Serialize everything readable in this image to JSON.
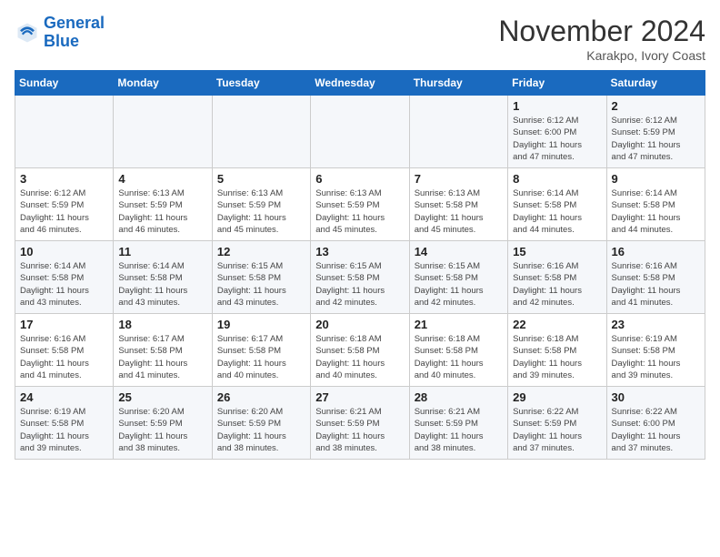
{
  "logo": {
    "name1": "General",
    "name2": "Blue"
  },
  "title": "November 2024",
  "location": "Karakpo, Ivory Coast",
  "weekdays": [
    "Sunday",
    "Monday",
    "Tuesday",
    "Wednesday",
    "Thursday",
    "Friday",
    "Saturday"
  ],
  "weeks": [
    [
      {
        "day": "",
        "info": ""
      },
      {
        "day": "",
        "info": ""
      },
      {
        "day": "",
        "info": ""
      },
      {
        "day": "",
        "info": ""
      },
      {
        "day": "",
        "info": ""
      },
      {
        "day": "1",
        "info": "Sunrise: 6:12 AM\nSunset: 6:00 PM\nDaylight: 11 hours\nand 47 minutes."
      },
      {
        "day": "2",
        "info": "Sunrise: 6:12 AM\nSunset: 5:59 PM\nDaylight: 11 hours\nand 47 minutes."
      }
    ],
    [
      {
        "day": "3",
        "info": "Sunrise: 6:12 AM\nSunset: 5:59 PM\nDaylight: 11 hours\nand 46 minutes."
      },
      {
        "day": "4",
        "info": "Sunrise: 6:13 AM\nSunset: 5:59 PM\nDaylight: 11 hours\nand 46 minutes."
      },
      {
        "day": "5",
        "info": "Sunrise: 6:13 AM\nSunset: 5:59 PM\nDaylight: 11 hours\nand 45 minutes."
      },
      {
        "day": "6",
        "info": "Sunrise: 6:13 AM\nSunset: 5:59 PM\nDaylight: 11 hours\nand 45 minutes."
      },
      {
        "day": "7",
        "info": "Sunrise: 6:13 AM\nSunset: 5:58 PM\nDaylight: 11 hours\nand 45 minutes."
      },
      {
        "day": "8",
        "info": "Sunrise: 6:14 AM\nSunset: 5:58 PM\nDaylight: 11 hours\nand 44 minutes."
      },
      {
        "day": "9",
        "info": "Sunrise: 6:14 AM\nSunset: 5:58 PM\nDaylight: 11 hours\nand 44 minutes."
      }
    ],
    [
      {
        "day": "10",
        "info": "Sunrise: 6:14 AM\nSunset: 5:58 PM\nDaylight: 11 hours\nand 43 minutes."
      },
      {
        "day": "11",
        "info": "Sunrise: 6:14 AM\nSunset: 5:58 PM\nDaylight: 11 hours\nand 43 minutes."
      },
      {
        "day": "12",
        "info": "Sunrise: 6:15 AM\nSunset: 5:58 PM\nDaylight: 11 hours\nand 43 minutes."
      },
      {
        "day": "13",
        "info": "Sunrise: 6:15 AM\nSunset: 5:58 PM\nDaylight: 11 hours\nand 42 minutes."
      },
      {
        "day": "14",
        "info": "Sunrise: 6:15 AM\nSunset: 5:58 PM\nDaylight: 11 hours\nand 42 minutes."
      },
      {
        "day": "15",
        "info": "Sunrise: 6:16 AM\nSunset: 5:58 PM\nDaylight: 11 hours\nand 42 minutes."
      },
      {
        "day": "16",
        "info": "Sunrise: 6:16 AM\nSunset: 5:58 PM\nDaylight: 11 hours\nand 41 minutes."
      }
    ],
    [
      {
        "day": "17",
        "info": "Sunrise: 6:16 AM\nSunset: 5:58 PM\nDaylight: 11 hours\nand 41 minutes."
      },
      {
        "day": "18",
        "info": "Sunrise: 6:17 AM\nSunset: 5:58 PM\nDaylight: 11 hours\nand 41 minutes."
      },
      {
        "day": "19",
        "info": "Sunrise: 6:17 AM\nSunset: 5:58 PM\nDaylight: 11 hours\nand 40 minutes."
      },
      {
        "day": "20",
        "info": "Sunrise: 6:18 AM\nSunset: 5:58 PM\nDaylight: 11 hours\nand 40 minutes."
      },
      {
        "day": "21",
        "info": "Sunrise: 6:18 AM\nSunset: 5:58 PM\nDaylight: 11 hours\nand 40 minutes."
      },
      {
        "day": "22",
        "info": "Sunrise: 6:18 AM\nSunset: 5:58 PM\nDaylight: 11 hours\nand 39 minutes."
      },
      {
        "day": "23",
        "info": "Sunrise: 6:19 AM\nSunset: 5:58 PM\nDaylight: 11 hours\nand 39 minutes."
      }
    ],
    [
      {
        "day": "24",
        "info": "Sunrise: 6:19 AM\nSunset: 5:58 PM\nDaylight: 11 hours\nand 39 minutes."
      },
      {
        "day": "25",
        "info": "Sunrise: 6:20 AM\nSunset: 5:59 PM\nDaylight: 11 hours\nand 38 minutes."
      },
      {
        "day": "26",
        "info": "Sunrise: 6:20 AM\nSunset: 5:59 PM\nDaylight: 11 hours\nand 38 minutes."
      },
      {
        "day": "27",
        "info": "Sunrise: 6:21 AM\nSunset: 5:59 PM\nDaylight: 11 hours\nand 38 minutes."
      },
      {
        "day": "28",
        "info": "Sunrise: 6:21 AM\nSunset: 5:59 PM\nDaylight: 11 hours\nand 38 minutes."
      },
      {
        "day": "29",
        "info": "Sunrise: 6:22 AM\nSunset: 5:59 PM\nDaylight: 11 hours\nand 37 minutes."
      },
      {
        "day": "30",
        "info": "Sunrise: 6:22 AM\nSunset: 6:00 PM\nDaylight: 11 hours\nand 37 minutes."
      }
    ]
  ]
}
